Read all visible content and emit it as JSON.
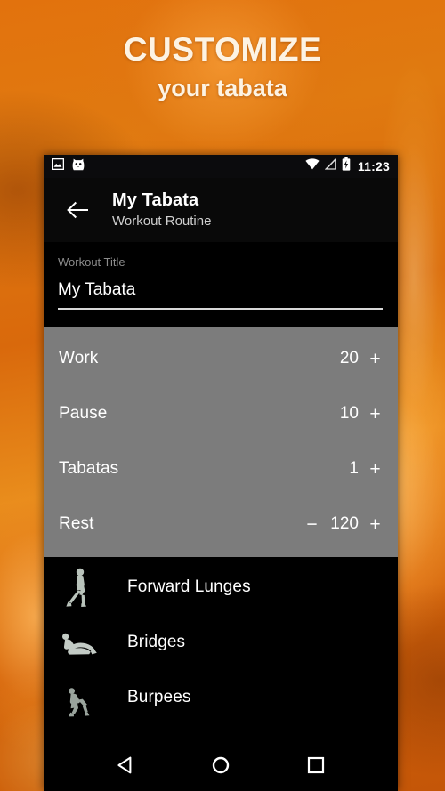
{
  "promo": {
    "line1": "CUSTOMIZE",
    "line2": "your tabata",
    "text_color": "#fdf3e3",
    "background_color": "#e0760e"
  },
  "statusbar": {
    "left_icons": [
      "image-icon",
      "cat-notification-icon"
    ],
    "right_icons": [
      "wifi-icon",
      "signal-off-icon",
      "battery-charging-icon"
    ],
    "clock": "11:23"
  },
  "appbar": {
    "back_icon": "back-arrow-icon",
    "title": "My Tabata",
    "subtitle": "Workout Routine"
  },
  "title_field": {
    "label": "Workout Title",
    "value": "My Tabata",
    "placeholder": "Workout Title"
  },
  "settings": {
    "panel_color": "#7c7c7c",
    "rows": [
      {
        "label": "Work",
        "value": "20",
        "minus": "−",
        "plus": "+",
        "has_minus": false
      },
      {
        "label": "Pause",
        "value": "10",
        "minus": "−",
        "plus": "+",
        "has_minus": false
      },
      {
        "label": "Tabatas",
        "value": "1",
        "minus": "−",
        "plus": "+",
        "has_minus": false
      },
      {
        "label": "Rest",
        "value": "120",
        "minus": "−",
        "plus": "+",
        "has_minus": true
      }
    ]
  },
  "exercises": [
    {
      "name": "Forward Lunges",
      "thumb": "lunge-figure-icon"
    },
    {
      "name": "Bridges",
      "thumb": "bridge-figure-icon"
    },
    {
      "name": "Burpees",
      "thumb": "burpee-figure-icon"
    }
  ],
  "navbar": {
    "back": "nav-back-icon",
    "home": "nav-home-icon",
    "recents": "nav-recents-icon"
  }
}
